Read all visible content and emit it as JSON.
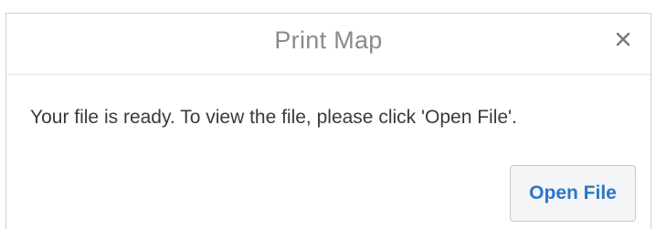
{
  "dialog": {
    "title": "Print Map",
    "close_icon": "close-icon",
    "message": "Your file is ready. To view the file, please click 'Open File'.",
    "open_button_label": "Open File",
    "accent_color": "#2a77c9"
  }
}
